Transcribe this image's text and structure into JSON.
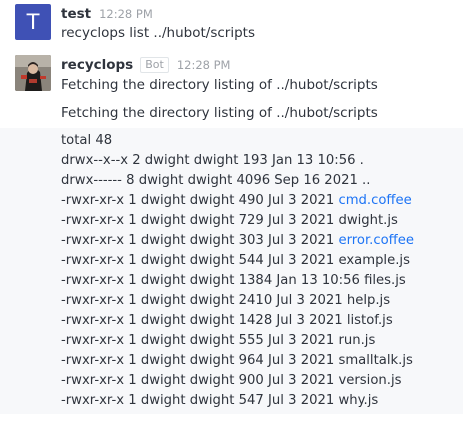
{
  "messages": [
    {
      "username": "test",
      "avatar_letter": "T",
      "avatar_color": "#3f51b5",
      "time": "12:28 PM",
      "text": "recyclops list ../hubot/scripts"
    },
    {
      "username": "recyclops",
      "bot_tag": "Bot",
      "time": "12:28 PM",
      "text": "Fetching the directory listing of ../hubot/scripts",
      "text2": "Fetching the directory listing of ../hubot/scripts"
    }
  ],
  "listing": [
    {
      "pre": "total 48",
      "link": "",
      "post": ""
    },
    {
      "pre": "drwx--x--x 2 dwight dwight 193 Jan 13 10:56 .",
      "link": "",
      "post": ""
    },
    {
      "pre": "drwx------ 8 dwight dwight 4096 Sep 16 2021 ..",
      "link": "",
      "post": ""
    },
    {
      "pre": "-rwxr-xr-x 1 dwight dwight 490 Jul 3 2021 ",
      "link": "cmd.coffee",
      "post": ""
    },
    {
      "pre": "-rwxr-xr-x 1 dwight dwight 729 Jul 3 2021 dwight.js",
      "link": "",
      "post": ""
    },
    {
      "pre": "-rwxr-xr-x 1 dwight dwight 303 Jul 3 2021 ",
      "link": "error.coffee",
      "post": ""
    },
    {
      "pre": "-rwxr-xr-x 1 dwight dwight 544 Jul 3 2021 example.js",
      "link": "",
      "post": ""
    },
    {
      "pre": "-rwxr-xr-x 1 dwight dwight 1384 Jan 13 10:56 files.js",
      "link": "",
      "post": ""
    },
    {
      "pre": "-rwxr-xr-x 1 dwight dwight 2410 Jul 3 2021 help.js",
      "link": "",
      "post": ""
    },
    {
      "pre": "-rwxr-xr-x 1 dwight dwight 1428 Jul 3 2021 listof.js",
      "link": "",
      "post": ""
    },
    {
      "pre": "-rwxr-xr-x 1 dwight dwight 555 Jul 3 2021 run.js",
      "link": "",
      "post": ""
    },
    {
      "pre": "-rwxr-xr-x 1 dwight dwight 964 Jul 3 2021 smalltalk.js",
      "link": "",
      "post": ""
    },
    {
      "pre": "-rwxr-xr-x 1 dwight dwight 900 Jul 3 2021 version.js",
      "link": "",
      "post": ""
    },
    {
      "pre": "-rwxr-xr-x 1 dwight dwight 547 Jul 3 2021 why.js",
      "link": "",
      "post": ""
    }
  ],
  "colors": {
    "link": "#1d74f5",
    "highlight_bg": "#f7f8fa",
    "avatar_t": "#3f51b5"
  },
  "icons": {
    "bot_avatar": "robot-costume-avatar-icon"
  }
}
